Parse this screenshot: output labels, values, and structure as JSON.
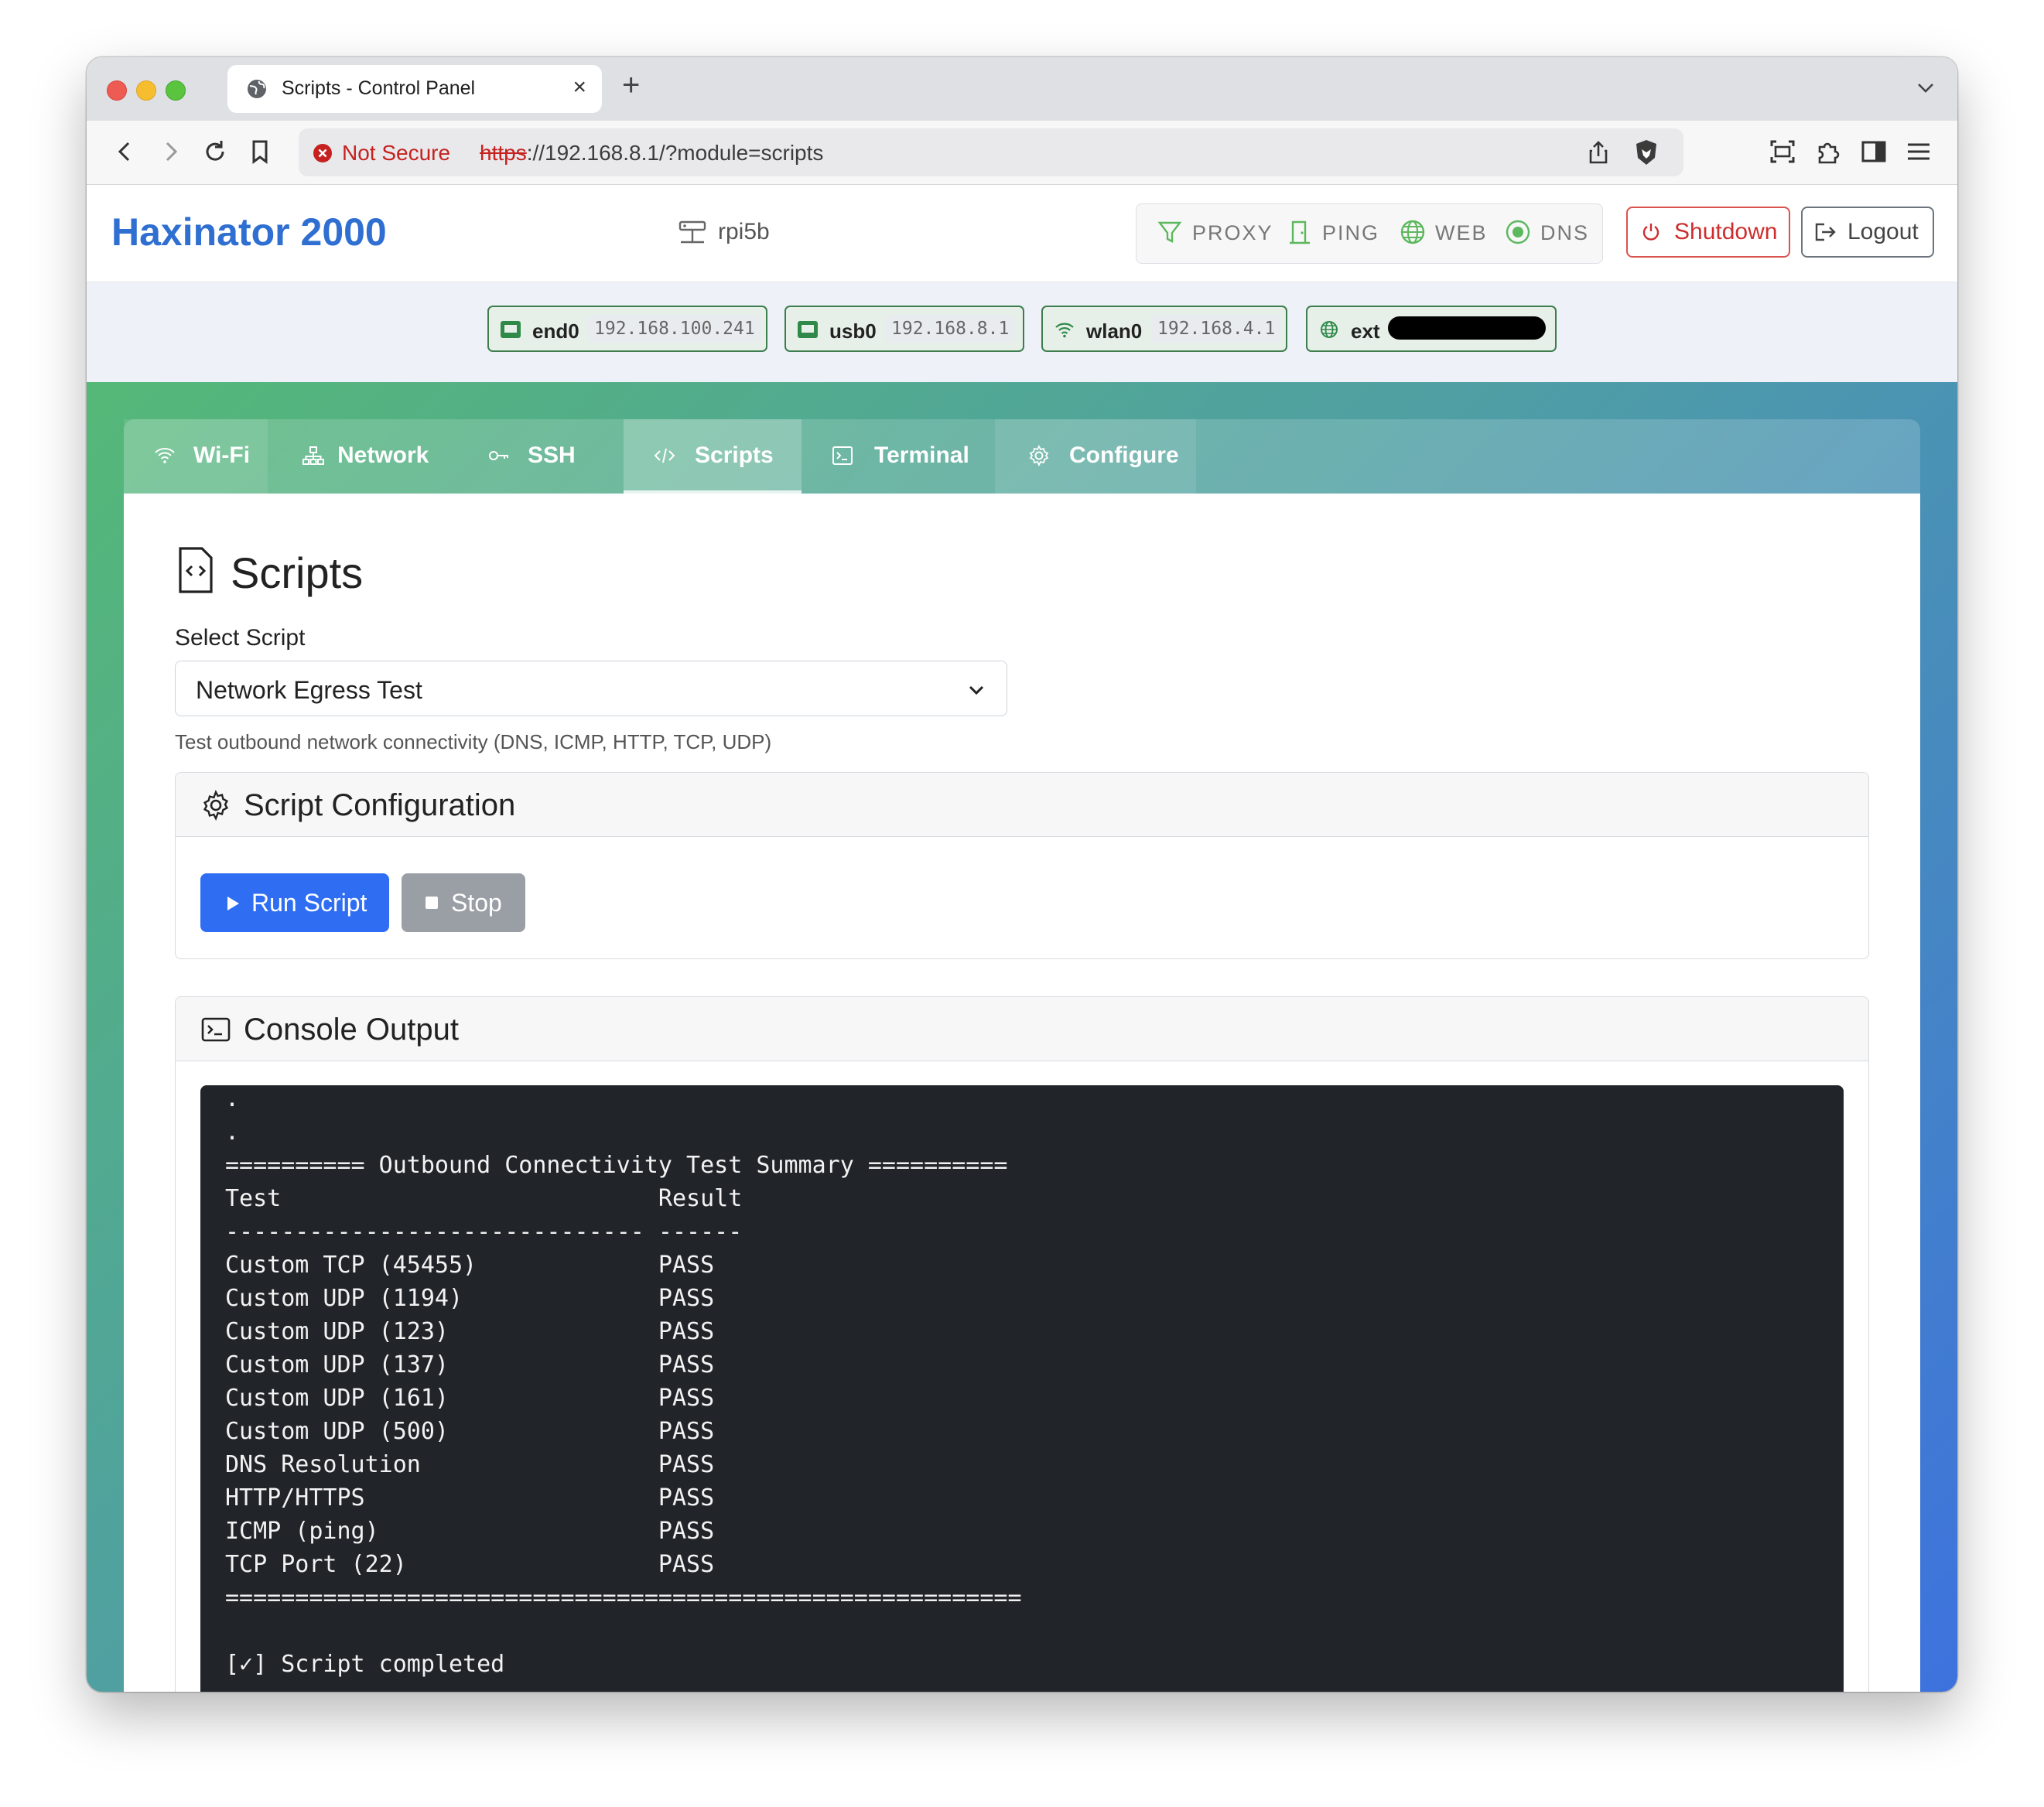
{
  "browser": {
    "tab_title": "Scripts - Control Panel",
    "new_tab": "+",
    "close_tab": "×",
    "security_label": "Not Secure",
    "url_scheme": "https",
    "url_rest": "://192.168.8.1/?module=scripts"
  },
  "app": {
    "brand": "Haxinator 2000",
    "hostname": "rpi5b",
    "services": [
      {
        "label": "PROXY",
        "icon": "filter-icon",
        "color": "#5cb85c"
      },
      {
        "label": "PING",
        "icon": "door-icon",
        "color": "#5cb85c"
      },
      {
        "label": "WEB",
        "icon": "globe-icon",
        "color": "#5cb85c"
      },
      {
        "label": "DNS",
        "icon": "dns-icon",
        "color": "#5cb85c"
      }
    ],
    "shutdown_label": "Shutdown",
    "logout_label": "Logout"
  },
  "interfaces": [
    {
      "name": "end0",
      "addr": "192.168.100.241",
      "icon": "ethernet-icon"
    },
    {
      "name": "usb0",
      "addr": "192.168.8.1",
      "icon": "ethernet-icon"
    },
    {
      "name": "wlan0",
      "addr": "192.168.4.1",
      "icon": "wifi-icon"
    },
    {
      "name": "ext",
      "addr": "",
      "icon": "globe-icon",
      "redacted": true
    }
  ],
  "nav_tabs": [
    {
      "label": "Wi-Fi",
      "icon": "wifi-icon"
    },
    {
      "label": "Network",
      "icon": "network-icon"
    },
    {
      "label": "SSH",
      "icon": "key-icon"
    },
    {
      "label": "Scripts",
      "icon": "code-icon",
      "active": true
    },
    {
      "label": "Terminal",
      "icon": "terminal-icon"
    },
    {
      "label": "Configure",
      "icon": "gear-icon"
    }
  ],
  "page": {
    "title": "Scripts",
    "select_label": "Select Script",
    "selected_script": "Network Egress Test",
    "script_description": "Test outbound network connectivity (DNS, ICMP, HTTP, TCP, UDP)",
    "config_title": "Script Configuration",
    "run_label": "Run Script",
    "stop_label": "Stop",
    "console_title": "Console Output"
  },
  "console_lines": [
    ".",
    ".",
    "========== Outbound Connectivity Test Summary ==========",
    "Test                           Result",
    "------------------------------ ------",
    "Custom TCP (45455)             PASS",
    "Custom UDP (1194)              PASS",
    "Custom UDP (123)               PASS",
    "Custom UDP (137)               PASS",
    "Custom UDP (161)               PASS",
    "Custom UDP (500)               PASS",
    "DNS Resolution                 PASS",
    "HTTP/HTTPS                     PASS",
    "ICMP (ping)                    PASS",
    "TCP Port (22)                  PASS",
    "=========================================================",
    "",
    "[✓] Script completed"
  ]
}
